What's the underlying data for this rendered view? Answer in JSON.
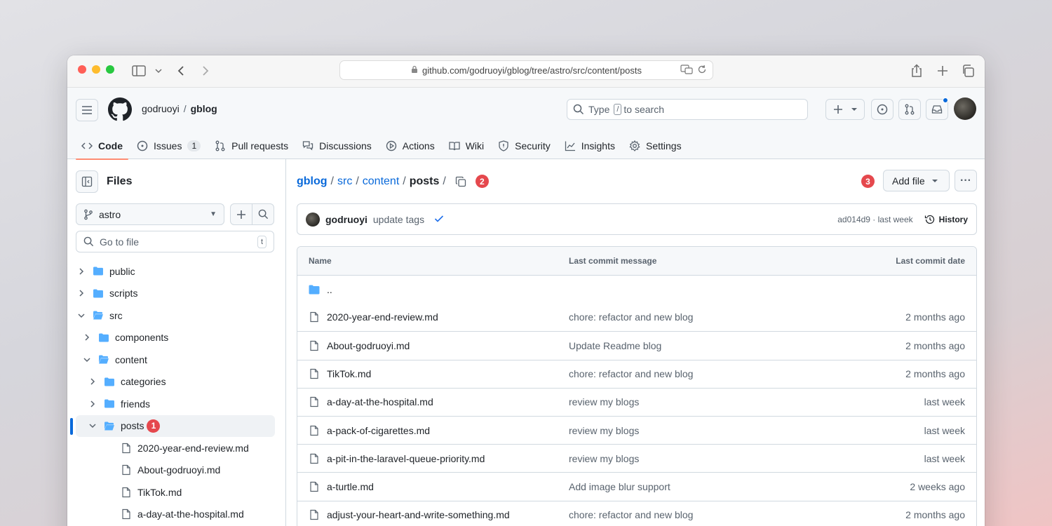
{
  "browser": {
    "url": "github.com/godruoyi/gblog/tree/astro/src/content/posts"
  },
  "header": {
    "owner": "godruoyi",
    "separator": "/",
    "repo": "gblog",
    "search_prefix": "Type",
    "search_key": "/",
    "search_suffix": "to search"
  },
  "repo_nav": [
    {
      "label": "Code",
      "icon": "code-icon",
      "active": true
    },
    {
      "label": "Issues",
      "icon": "issue-icon",
      "count": "1"
    },
    {
      "label": "Pull requests",
      "icon": "pull-request-icon"
    },
    {
      "label": "Discussions",
      "icon": "discussion-icon"
    },
    {
      "label": "Actions",
      "icon": "play-icon"
    },
    {
      "label": "Wiki",
      "icon": "book-icon"
    },
    {
      "label": "Security",
      "icon": "shield-icon"
    },
    {
      "label": "Insights",
      "icon": "graph-icon"
    },
    {
      "label": "Settings",
      "icon": "gear-icon"
    }
  ],
  "sidebar": {
    "title": "Files",
    "branch": "astro",
    "goto_placeholder": "Go to file",
    "goto_key": "t",
    "tree": [
      {
        "label": "public",
        "type": "folder",
        "expanded": false,
        "depth": 0
      },
      {
        "label": "scripts",
        "type": "folder",
        "expanded": false,
        "depth": 0
      },
      {
        "label": "src",
        "type": "folder",
        "expanded": true,
        "depth": 0
      },
      {
        "label": "components",
        "type": "folder",
        "expanded": false,
        "depth": 1
      },
      {
        "label": "content",
        "type": "folder",
        "expanded": true,
        "depth": 1
      },
      {
        "label": "categories",
        "type": "folder",
        "expanded": false,
        "depth": 2
      },
      {
        "label": "friends",
        "type": "folder",
        "expanded": false,
        "depth": 2
      },
      {
        "label": "posts",
        "type": "folder",
        "expanded": true,
        "depth": 2,
        "selected": true,
        "badge": "1"
      },
      {
        "label": "2020-year-end-review.md",
        "type": "file",
        "depth": 3
      },
      {
        "label": "About-godruoyi.md",
        "type": "file",
        "depth": 3
      },
      {
        "label": "TikTok.md",
        "type": "file",
        "depth": 3
      },
      {
        "label": "a-day-at-the-hospital.md",
        "type": "file",
        "depth": 3
      }
    ]
  },
  "main": {
    "breadcrumb": {
      "repo": "gblog",
      "parts": [
        "src",
        "content"
      ],
      "current": "posts",
      "sep": "/",
      "badge": "2"
    },
    "add_file_label": "Add file",
    "add_file_badge": "3",
    "more_label": "···",
    "commit": {
      "author": "godruoyi",
      "message": "update tags",
      "sha_time": "ad014d9 · last week",
      "history_label": "History"
    },
    "table": {
      "headers": {
        "name": "Name",
        "message": "Last commit message",
        "date": "Last commit date"
      },
      "parent": "..",
      "rows": [
        {
          "name": "2020-year-end-review.md",
          "message": "chore: refactor and new blog",
          "date": "2 months ago"
        },
        {
          "name": "About-godruoyi.md",
          "message": "Update Readme blog",
          "date": "2 months ago"
        },
        {
          "name": "TikTok.md",
          "message": "chore: refactor and new blog",
          "date": "2 months ago"
        },
        {
          "name": "a-day-at-the-hospital.md",
          "message": "review my blogs",
          "date": "last week"
        },
        {
          "name": "a-pack-of-cigarettes.md",
          "message": "review my blogs",
          "date": "last week"
        },
        {
          "name": "a-pit-in-the-laravel-queue-priority.md",
          "message": "review my blogs",
          "date": "last week"
        },
        {
          "name": "a-turtle.md",
          "message": "Add image blur support",
          "date": "2 weeks ago"
        },
        {
          "name": "adjust-your-heart-and-write-something.md",
          "message": "chore: refactor and new blog",
          "date": "2 months ago"
        }
      ]
    }
  },
  "colors": {
    "link": "#0969da",
    "badge": "#e5484d",
    "folder": "#54aeff",
    "active_underline": "#fd8c73"
  }
}
